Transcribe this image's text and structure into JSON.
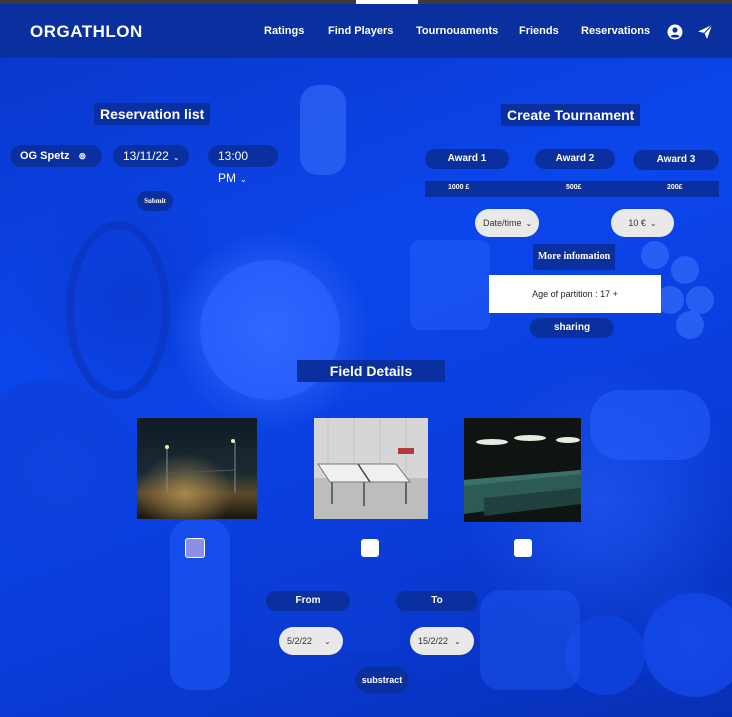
{
  "app": {
    "brand": "ORGATHLON"
  },
  "nav": {
    "links": [
      "Ratings",
      "Find Players",
      "Tournouaments",
      "Friends",
      "Reservations"
    ],
    "icons": [
      "account-circle-icon",
      "send-paper-plane-icon"
    ]
  },
  "reservation": {
    "title": "Reservation list",
    "location": "OG Spetz",
    "date": "13/11/22",
    "time": "13:00 PM",
    "submit_label": "Submit"
  },
  "tournament": {
    "title": "Create Tournament",
    "awards": [
      {
        "label": "Award 1",
        "value": "1000 £"
      },
      {
        "label": "Award 2",
        "value": "500£"
      },
      {
        "label": "Award 3",
        "value": "200£"
      }
    ],
    "datetime_placeholder": "Date/time",
    "fee": "10 €",
    "more_info_label": "More infomation",
    "age_text": "Age of partition : 17 +",
    "sharing_label": "sharing"
  },
  "fields": {
    "title": "Field Details",
    "items": [
      {
        "name": "outdoor-field-night",
        "checked": true
      },
      {
        "name": "ping-pong-table",
        "checked": false
      },
      {
        "name": "billiard-hall",
        "checked": false
      }
    ],
    "from_label": "From",
    "to_label": "To",
    "from_date": "5/2/22",
    "to_date": "15/2/22",
    "submit_label": "substract"
  },
  "colors": {
    "nav_bg": "#0a2f9f",
    "page_bg": "#0a3fe0",
    "checked": "#8b8fe8"
  }
}
